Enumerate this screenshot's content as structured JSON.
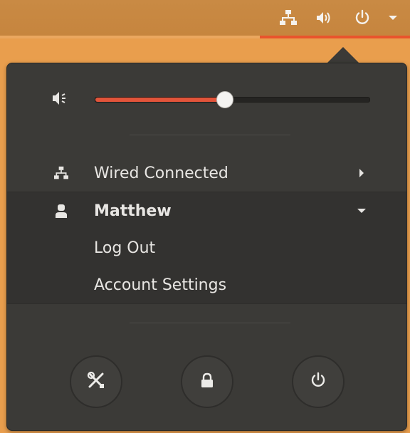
{
  "topbar": {
    "tray_icons": [
      "network-wired-icon",
      "volume-icon",
      "power-icon",
      "caret-down-icon"
    ]
  },
  "menu": {
    "volume": {
      "icon": "volume-muted-icon",
      "level": 0.47
    },
    "network": {
      "label": "Wired Connected",
      "icon": "network-wired-icon",
      "chevron": "chevron-right-icon"
    },
    "user": {
      "name": "Matthew",
      "icon": "user-icon",
      "chevron": "caret-down-icon",
      "items": [
        {
          "label": "Log Out"
        },
        {
          "label": "Account Settings"
        }
      ]
    },
    "actions": [
      {
        "name": "settings",
        "icon": "tools-icon"
      },
      {
        "name": "lock",
        "icon": "lock-icon"
      },
      {
        "name": "power",
        "icon": "power-icon"
      }
    ]
  },
  "colors": {
    "accent": "#e9542c",
    "panel": "#c6853e",
    "menu_bg": "#3b3a37"
  }
}
